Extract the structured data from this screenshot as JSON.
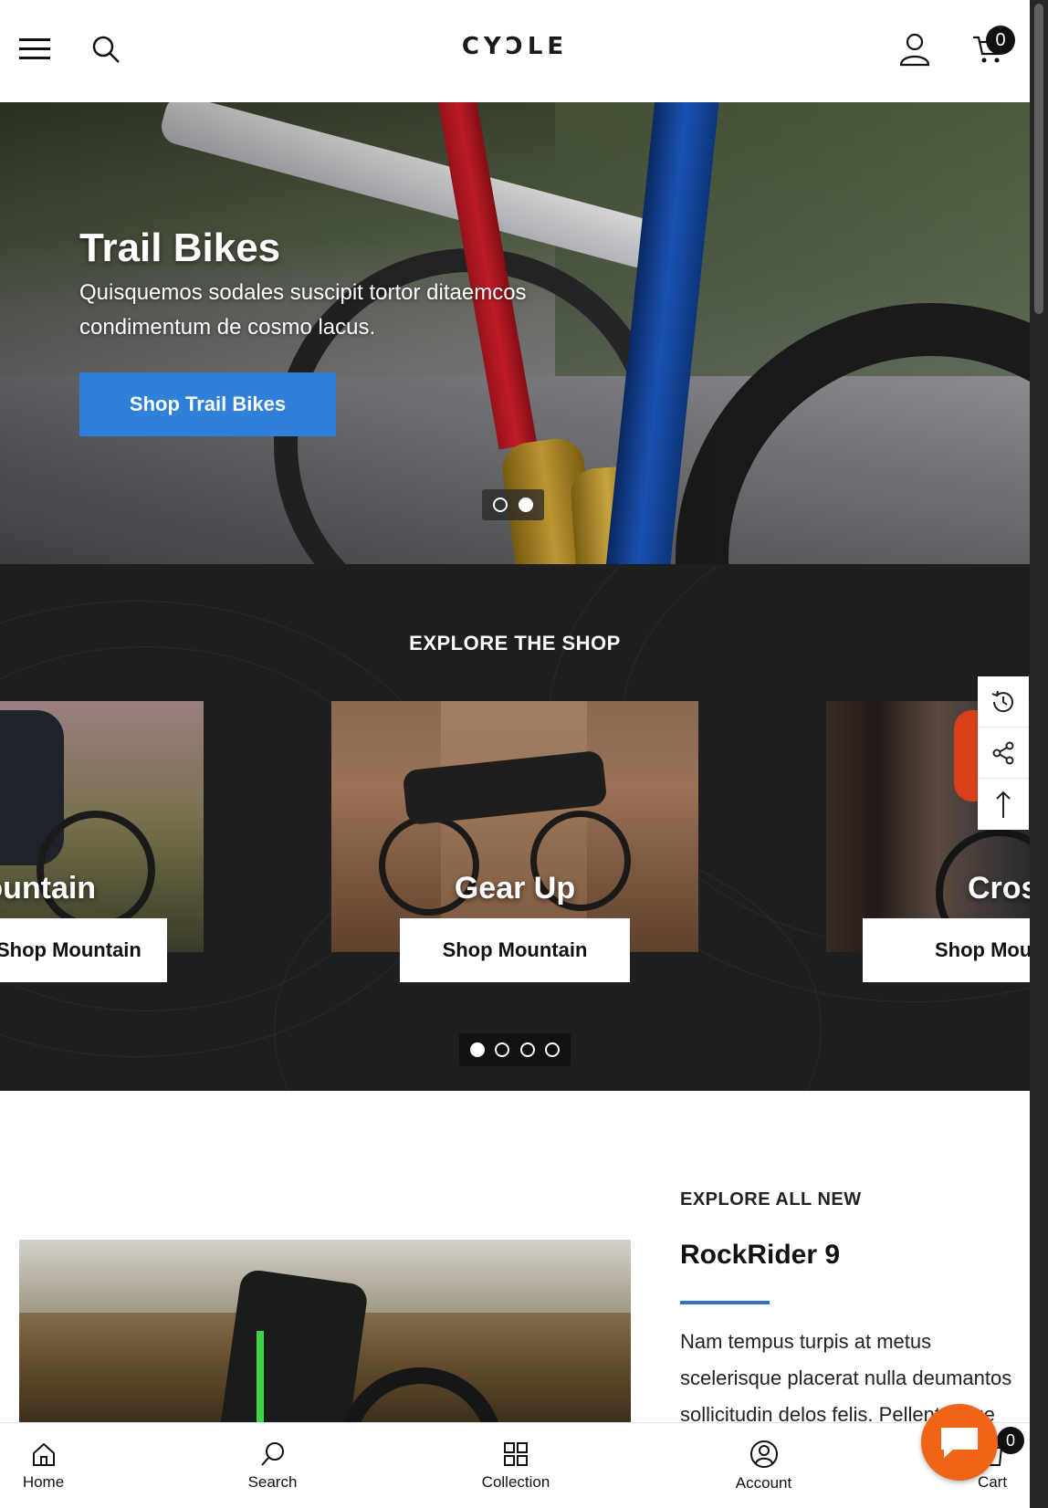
{
  "header": {
    "logo": "CYƆLE",
    "cart_count": "0"
  },
  "hero": {
    "title": "Trail Bikes",
    "subtitle": "Quisquemos sodales suscipit tortor ditaemcos condimentum de cosmo lacus.",
    "button_label": "Shop Trail Bikes",
    "slides_total": 2,
    "active_slide": 2
  },
  "explore": {
    "title": "EXPLORE THE SHOP",
    "cards": [
      {
        "label": "Mountain",
        "button_label": "Shop Mountain"
      },
      {
        "label": "Gear Up",
        "button_label": "Shop Mountain"
      },
      {
        "label": "Cross",
        "button_label": "Shop Mountain"
      }
    ],
    "slides_total": 4,
    "active_slide": 1
  },
  "feature": {
    "kicker": "EXPLORE ALL NEW",
    "title": "RockRider 9",
    "text": "Nam tempus turpis at metus scelerisque placerat nulla deumantos sollicitudin delos felis. Pellentesque"
  },
  "bottom_nav": {
    "items": [
      {
        "label": "Home",
        "icon": "home-icon"
      },
      {
        "label": "Search",
        "icon": "search-icon"
      },
      {
        "label": "Collection",
        "icon": "grid-icon"
      },
      {
        "label": "Account",
        "icon": "account-icon"
      },
      {
        "label": "Cart",
        "icon": "cart-icon"
      }
    ],
    "cart_count": "0"
  },
  "colors": {
    "accent_blue": "#2f80d8",
    "dark_section": "#1f1f1f",
    "chat_orange": "#f06418"
  }
}
